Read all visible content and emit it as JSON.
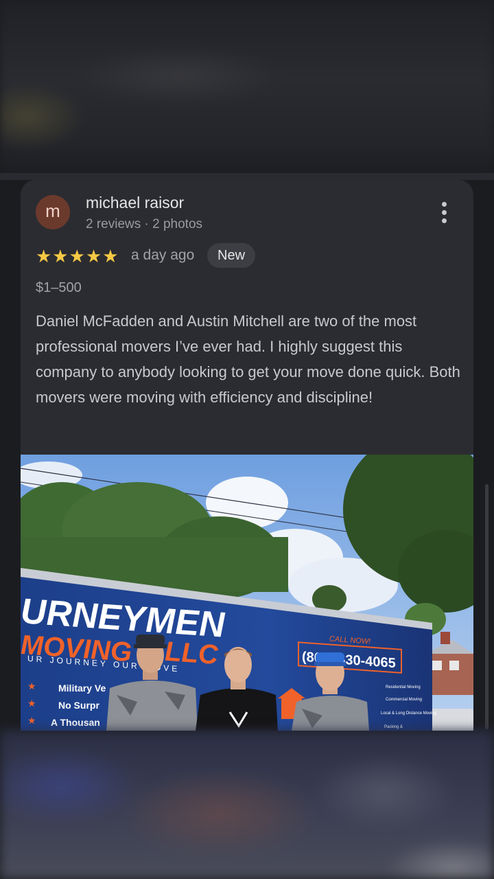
{
  "review": {
    "avatar_letter": "m",
    "reviewer_name": "michael raisor",
    "reviewer_meta": "2 reviews · 2 photos",
    "rating": 5,
    "stars": "★★★★★",
    "time": "a day ago",
    "badge": "New",
    "price": "$1–500",
    "text": "Daniel McFadden and Austin Mitchell are two of the most professional movers I’ve ever had. I highly suggest this company to anybody looking to get your move done quick. Both movers were moving with efficiency and discipline!"
  },
  "photo": {
    "truck_brand": "URNEYMEN",
    "truck_moving": "MOVING",
    "truck_llc": "LLC",
    "truck_tagline": "UR JOURNEY OUR MOVE",
    "truck_phone": "(865) 630-4065",
    "truck_call": "CALL NOW!",
    "truck_list": [
      "Military Ve",
      "No Surpr",
      "A Thousan"
    ],
    "truck_services": [
      "Residential Moving",
      "Commercial Moving",
      "Local & Long Distance Moving",
      "Packing &"
    ]
  },
  "colors": {
    "accent_star": "#f6c945",
    "card_bg": "#2b2c31",
    "avatar_bg": "#6b3a2d"
  }
}
